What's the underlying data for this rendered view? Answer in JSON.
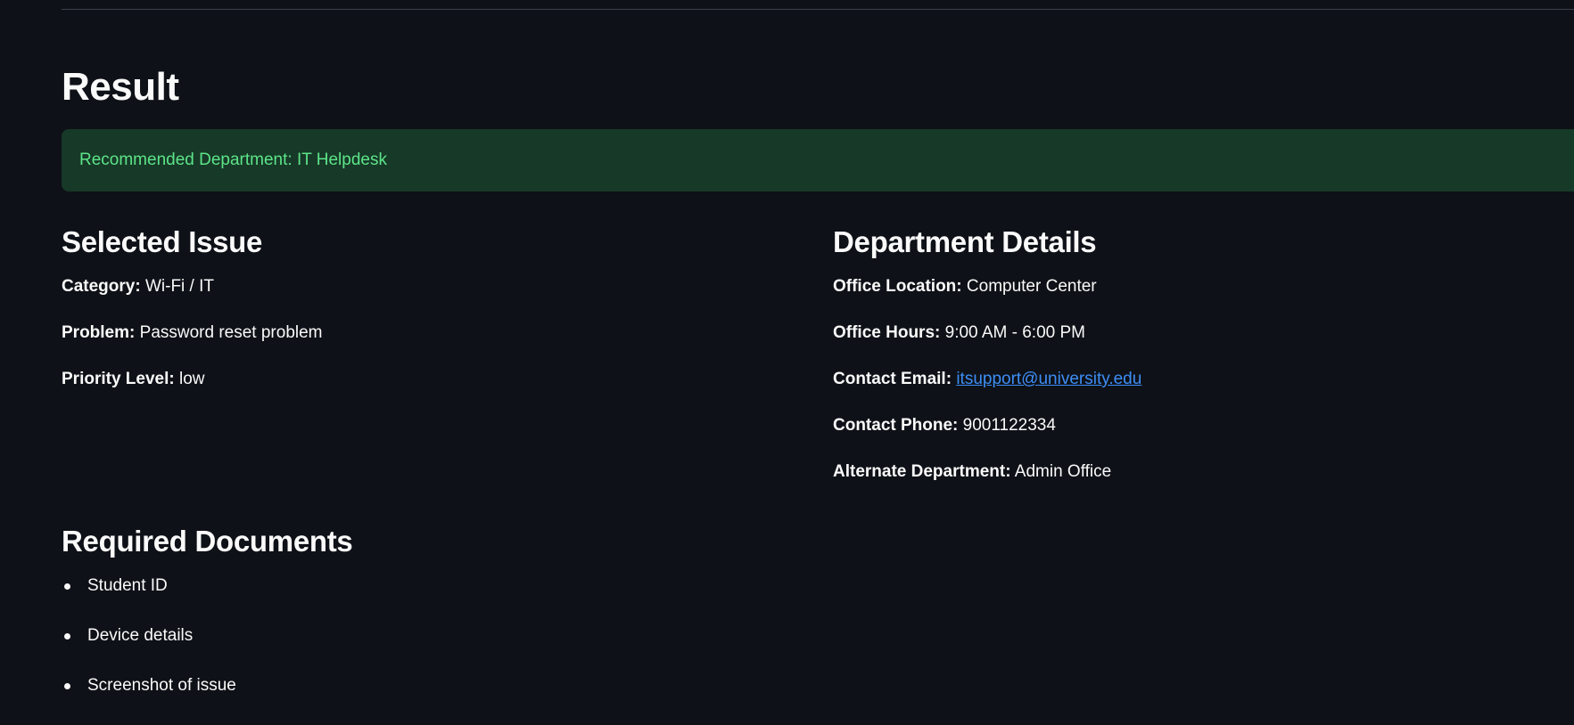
{
  "result": {
    "title": "Result",
    "success_message": "Recommended Department: IT Helpdesk"
  },
  "selected_issue": {
    "heading": "Selected Issue",
    "fields": [
      {
        "label": "Category:",
        "value": "Wi-Fi / IT"
      },
      {
        "label": "Problem:",
        "value": "Password reset problem"
      },
      {
        "label": "Priority Level:",
        "value": "low"
      }
    ]
  },
  "department_details": {
    "heading": "Department Details",
    "fields": [
      {
        "label": "Office Location:",
        "value": "Computer Center"
      },
      {
        "label": "Office Hours:",
        "value": "9:00 AM - 6:00 PM"
      },
      {
        "label": "Contact Email:",
        "value": "itsupport@university.edu",
        "is_link": true
      },
      {
        "label": "Contact Phone:",
        "value": "9001122334"
      },
      {
        "label": "Alternate Department:",
        "value": "Admin Office"
      }
    ]
  },
  "required_documents": {
    "heading": "Required Documents",
    "items": [
      "Student ID",
      "Device details",
      "Screenshot of issue"
    ]
  },
  "colors": {
    "background": "#0e1117",
    "success_bg": "#173928",
    "success_text": "#5ce488",
    "link": "#3d8ef5"
  }
}
